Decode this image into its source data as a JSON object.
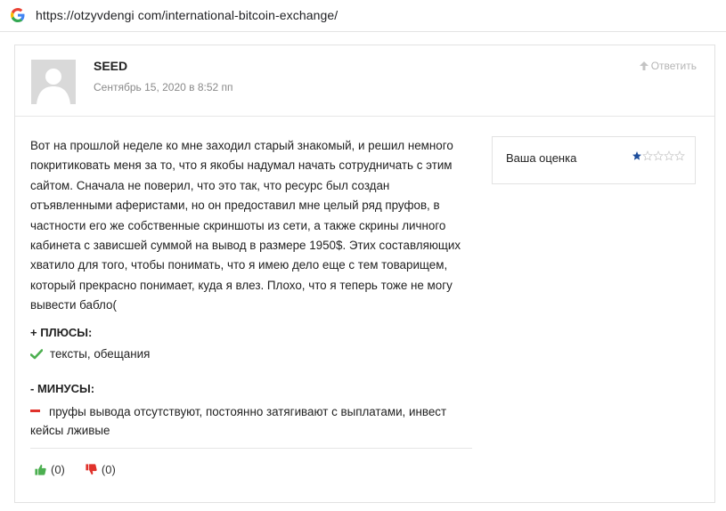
{
  "browser": {
    "url": "https://otzyvdengi com/international-bitcoin-exchange/"
  },
  "review": {
    "author": "SEED",
    "date": "Сентябрь 15, 2020 в 8:52 пп",
    "reply_label": "Ответить",
    "text": "Вот на прошлой неделе ко мне заходил старый знакомый, и решил немного покритиковать меня за то, что я якобы надумал начать сотрудничать с этим сайтом. Сначала не поверил, что это так, что ресурс был создан отъявленными аферистами, но он предоставил мне целый ряд пруфов, в частности его же собственные скриншоты из сети, а также скрины личного кабинета с зависшей суммой на вывод в размере 1950$. Этих составляющих хватило для того, чтобы понимать, что я имею дело еще с тем товарищем, который прекрасно понимает, куда я влез. Плохо, что я теперь тоже не могу вывести бабло(",
    "rating": {
      "label": "Ваша оценка",
      "value": 1,
      "max": 5
    },
    "pros": {
      "title": "+ ПЛЮСЫ:",
      "items": [
        "тексты, обещания"
      ]
    },
    "cons": {
      "title": "- МИНУСЫ:",
      "items": [
        "пруфы вывода отсутствуют, постоянно затягивают с выплатами, инвест кейсы лживые"
      ]
    },
    "votes": {
      "up": "(0)",
      "down": "(0)"
    }
  },
  "colors": {
    "accent_green": "#4caf50",
    "accent_red": "#e0322b",
    "star_active": "#1e4e9c",
    "star_inactive": "#c9c9c9",
    "muted": "#8a8a8a"
  }
}
